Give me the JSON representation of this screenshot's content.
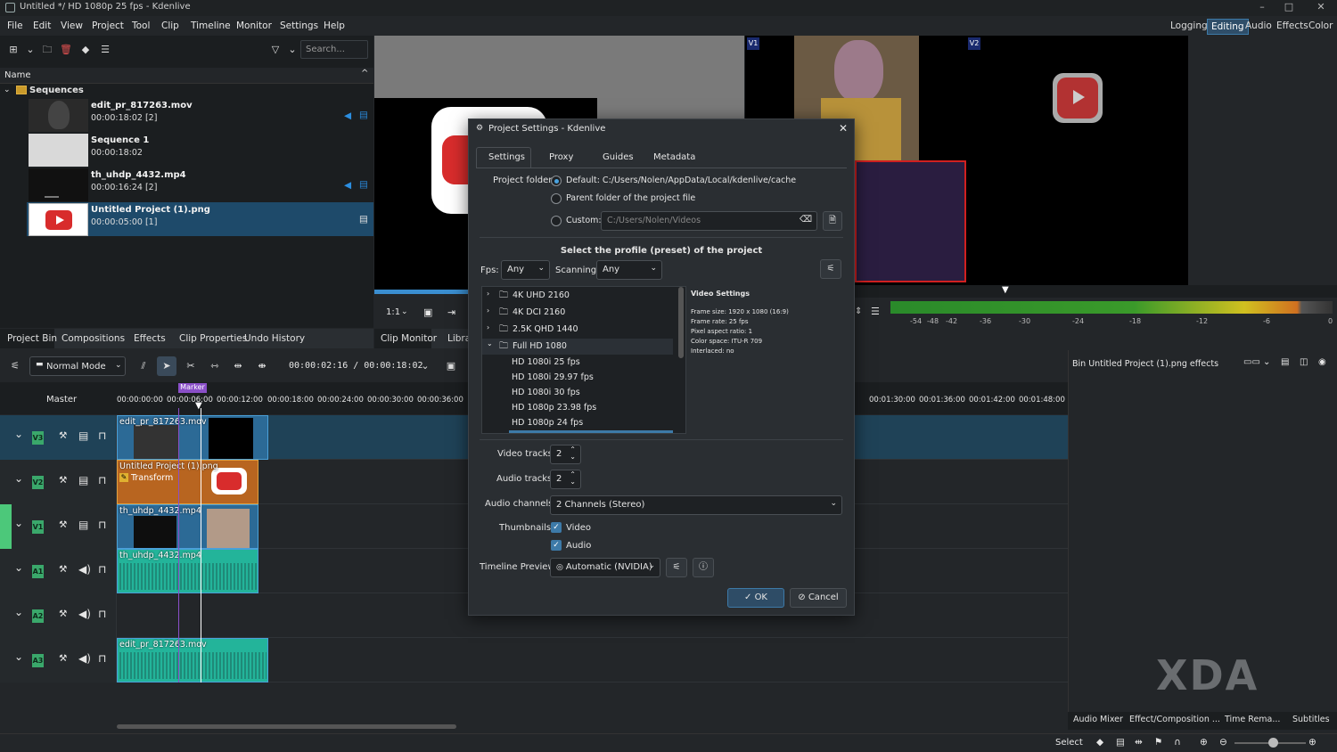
{
  "window": {
    "title": "Untitled */ HD 1080p 25 fps - Kdenlive"
  },
  "menu": [
    "File",
    "Edit",
    "View",
    "Project",
    "Tool",
    "Clip",
    "Timeline",
    "Monitor",
    "Settings",
    "Help"
  ],
  "layouts": [
    "Logging",
    "Editing",
    "Audio",
    "Effects",
    "Color"
  ],
  "active_layout": "Editing",
  "bin": {
    "search_placeholder": "Search...",
    "col_name": "Name",
    "folder": "Sequences",
    "items": [
      {
        "name": "edit_pr_817263.mov",
        "dur": "00:00:18:02 [2]"
      },
      {
        "name": "Sequence 1",
        "dur": "00:00:18:02"
      },
      {
        "name": "th_uhdp_4432.mp4",
        "dur": "00:00:16:24 [2]"
      },
      {
        "name": "Untitled Project (1).png",
        "dur": "00:00:05:00 [1]"
      }
    ]
  },
  "bin_tabs": [
    "Project Bin",
    "Compositions",
    "Effects",
    "Clip Properties",
    "Undo History"
  ],
  "clip_monitor_tabs": [
    "Clip Monitor",
    "Librar"
  ],
  "monitor": {
    "zoom": "1:1",
    "v1": "V1",
    "v2": "V2"
  },
  "meter_ticks": [
    "-54",
    "-48",
    "-42",
    "-36",
    "-30",
    "-24",
    "-18",
    "-12",
    "-6",
    "0"
  ],
  "timeline": {
    "mode": "Normal Mode",
    "timecode": "00:00:02:16 / 00:00:18:02",
    "master": "Master",
    "marker": "Marker",
    "ruler": [
      "00:00:00:00",
      "00:00:06:00",
      "00:00:12:00",
      "00:00:18:00",
      "00:00:24:00",
      "00:00:30:00",
      "00:00:36:00"
    ],
    "ruler_right": [
      "00:01:30:00",
      "00:01:36:00",
      "00:01:42:00",
      "00:01:48:00"
    ],
    "tracks": [
      {
        "label": "V3",
        "clip": "edit_pr_817263.mov"
      },
      {
        "label": "V2",
        "clip": "Untitled Project (1).png",
        "effect": "Transform"
      },
      {
        "label": "V1",
        "clip": "th_uhdp_4432.mp4"
      },
      {
        "label": "A1",
        "clip": "th_uhdp_4432.mp4"
      },
      {
        "label": "A2",
        "clip": ""
      },
      {
        "label": "A3",
        "clip": "edit_pr_817263.mov"
      }
    ]
  },
  "effects_panel": {
    "title": "Bin Untitled Project (1).png effects"
  },
  "bottom_tabs": [
    "Audio Mixer",
    "Effect/Composition ...",
    "Time Rema...",
    "Subtitles"
  ],
  "status": {
    "tool": "Select"
  },
  "watermark": "XDA",
  "dialog": {
    "title": "Project Settings - Kdenlive",
    "tabs": [
      "Settings",
      "Proxy",
      "Guides",
      "Metadata"
    ],
    "project_folder_label": "Project folder:",
    "opt_default": "Default: C:/Users/Nolen/AppData/Local/kdenlive/cache",
    "opt_parent": "Parent folder of the project file",
    "opt_custom": "Custom:",
    "custom_path": "C:/Users/Nolen/Videos",
    "profile_heading": "Select the profile (preset) of the project",
    "fps_label": "Fps:",
    "fps_value": "Any",
    "scan_label": "Scanning:",
    "scan_value": "Any",
    "tree": [
      "4K UHD 2160",
      "4K DCI 2160",
      "2.5K QHD 1440",
      "Full HD 1080",
      "HD 1080i 25 fps",
      "HD 1080i 29.97 fps",
      "HD 1080i 30 fps",
      "HD 1080p 23.98 fps",
      "HD 1080p 24 fps"
    ],
    "video_settings_title": "Video Settings",
    "video_settings": [
      "Frame size: 1920 x 1080 (16:9)",
      "Frame rate: 25 fps",
      "Pixel aspect ratio: 1",
      "Color space: ITU-R 709",
      "Interlaced: no"
    ],
    "video_tracks_label": "Video tracks:",
    "video_tracks": "2",
    "audio_tracks_label": "Audio tracks:",
    "audio_tracks": "2",
    "audio_channels_label": "Audio channels:",
    "audio_channels": "2 Channels (Stereo)",
    "thumbnails_label": "Thumbnails:",
    "thumb_video": "Video",
    "thumb_audio": "Audio",
    "preview_label": "Timeline Preview:",
    "preview_value": "Automatic (NVIDIA)",
    "ok": "OK",
    "cancel": "Cancel"
  }
}
